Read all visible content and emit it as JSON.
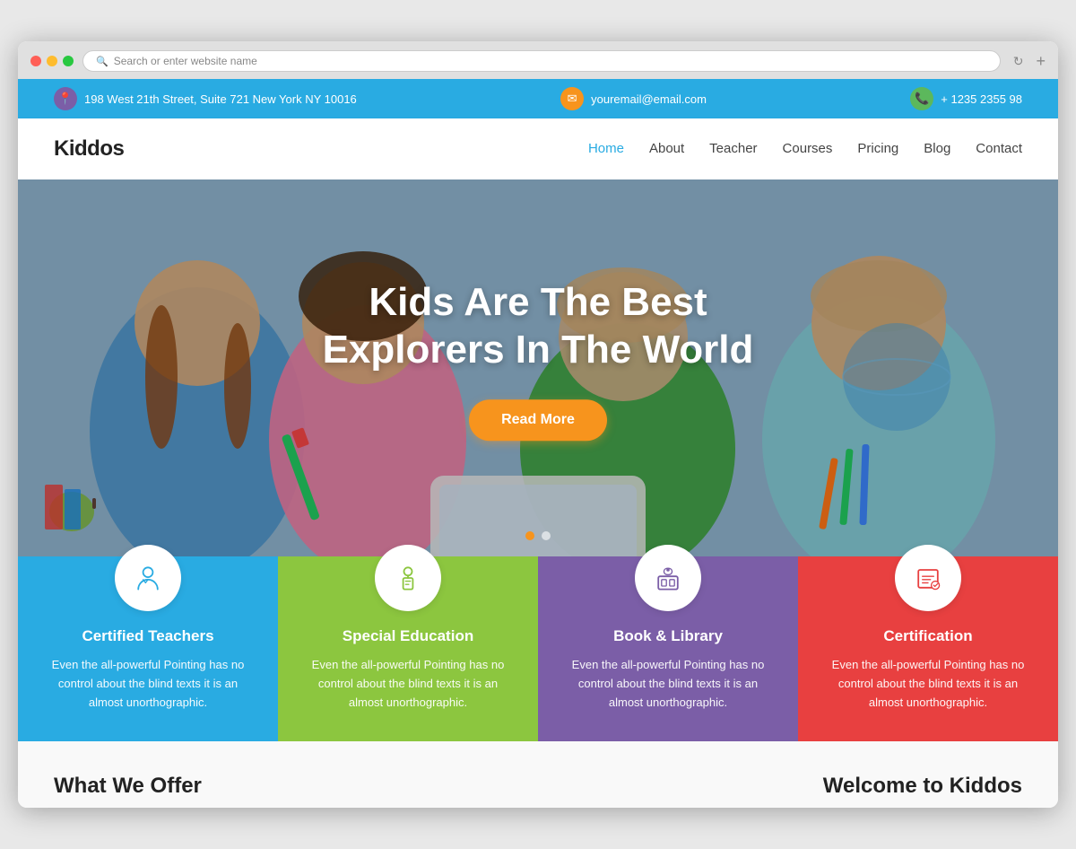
{
  "browser": {
    "address_placeholder": "Search or enter website name"
  },
  "topbar": {
    "address": "198 West 21th Street, Suite 721 New York NY 10016",
    "email": "youremail@email.com",
    "phone": "+ 1235 2355 98"
  },
  "navbar": {
    "logo": "Kiddos",
    "links": [
      {
        "label": "Home",
        "active": true
      },
      {
        "label": "About",
        "active": false
      },
      {
        "label": "Teacher",
        "active": false
      },
      {
        "label": "Courses",
        "active": false
      },
      {
        "label": "Pricing",
        "active": false
      },
      {
        "label": "Blog",
        "active": false
      },
      {
        "label": "Contact",
        "active": false
      }
    ]
  },
  "hero": {
    "title_line1": "Kids Are The Best",
    "title_line2": "Explorers In The World",
    "cta_button": "Read More"
  },
  "features": [
    {
      "title": "Certified Teachers",
      "desc": "Even the all-powerful Pointing has no control about the blind texts it is an almost unorthographic.",
      "color": "blue"
    },
    {
      "title": "Special Education",
      "desc": "Even the all-powerful Pointing has no control about the blind texts it is an almost unorthographic.",
      "color": "green"
    },
    {
      "title": "Book & Library",
      "desc": "Even the all-powerful Pointing has no control about the blind texts it is an almost unorthographic.",
      "color": "purple"
    },
    {
      "title": "Certification",
      "desc": "Even the all-powerful Pointing has no control about the blind texts it is an almost unorthographic.",
      "color": "red"
    }
  ],
  "bottom": {
    "left_heading": "What We Offer",
    "right_heading": "Welcome to Kiddos"
  }
}
